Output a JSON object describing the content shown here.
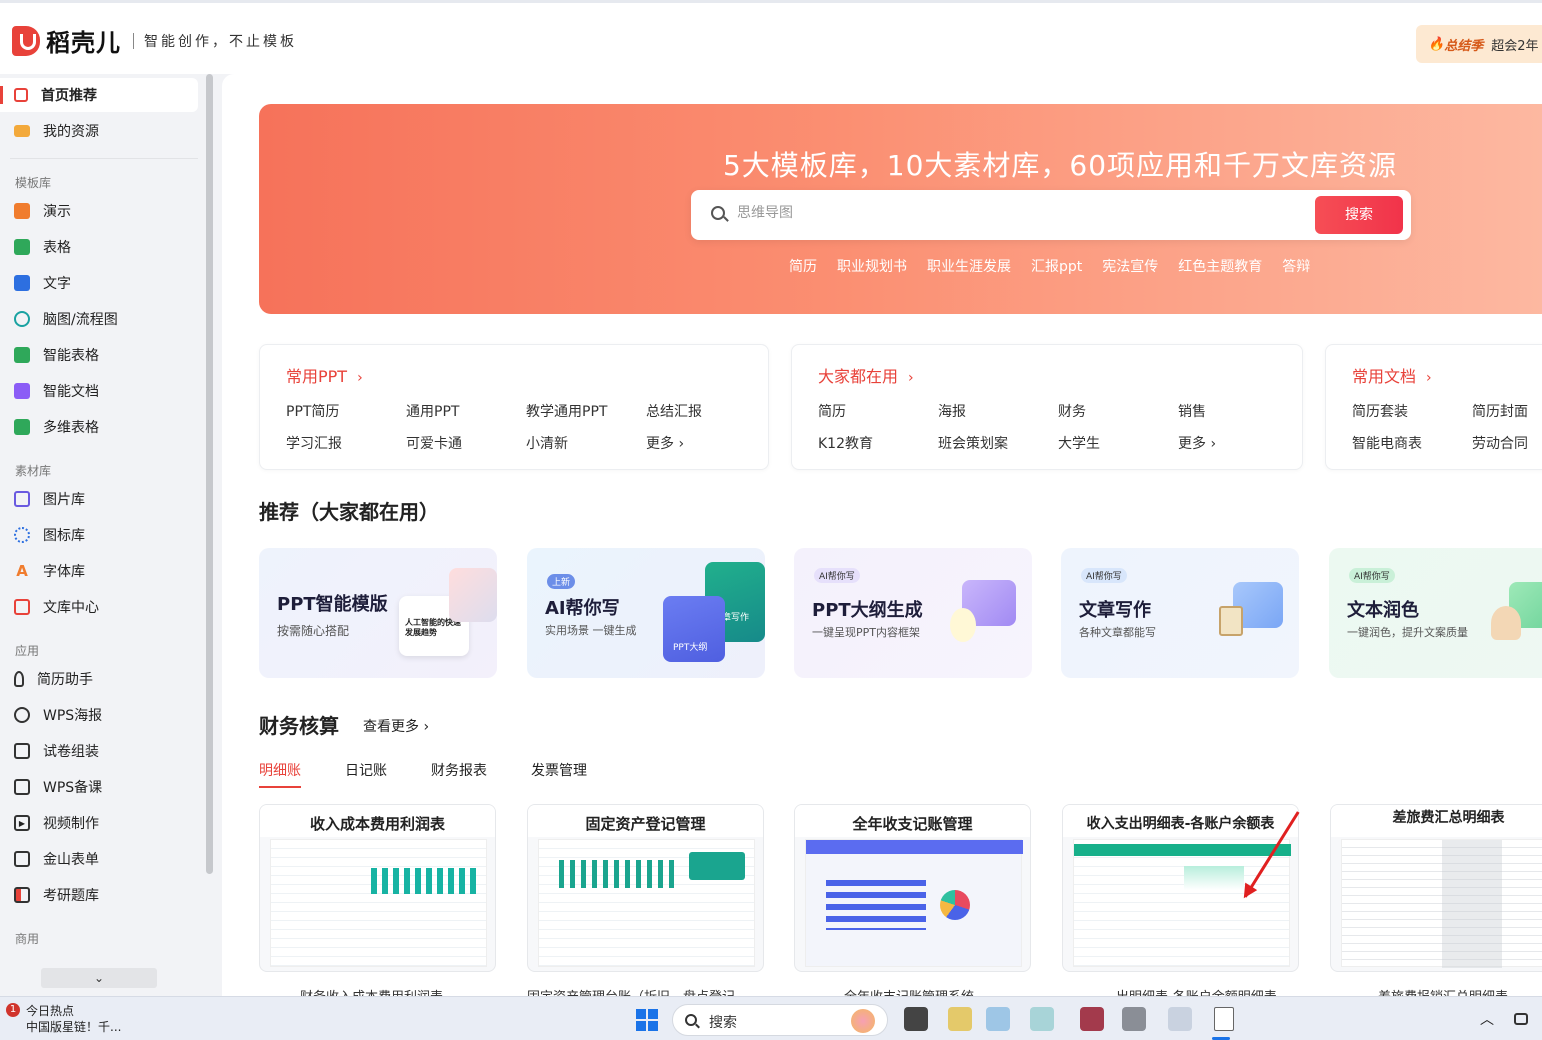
{
  "app": {
    "brand": "稻壳儿",
    "slogan": "智能创作，不止模板",
    "promo_label": "总结季",
    "promo_text": "超会2年"
  },
  "sidebar": {
    "top_items": [
      {
        "label": "首页推荐",
        "icon": "home-icon",
        "active": true
      },
      {
        "label": "我的资源",
        "icon": "folder-icon",
        "active": false
      }
    ],
    "sections": [
      {
        "title": "模板库",
        "items": [
          {
            "label": "演示",
            "icon": "presentation-icon"
          },
          {
            "label": "表格",
            "icon": "table-icon"
          },
          {
            "label": "文字",
            "icon": "document-icon"
          },
          {
            "label": "脑图/流程图",
            "icon": "mindmap-icon"
          },
          {
            "label": "智能表格",
            "icon": "smart-table-icon"
          },
          {
            "label": "智能文档",
            "icon": "smart-doc-icon"
          },
          {
            "label": "多维表格",
            "icon": "multidim-table-icon"
          }
        ]
      },
      {
        "title": "素材库",
        "items": [
          {
            "label": "图片库",
            "icon": "image-icon"
          },
          {
            "label": "图标库",
            "icon": "icons-icon"
          },
          {
            "label": "字体库",
            "icon": "font-icon"
          },
          {
            "label": "文库中心",
            "icon": "library-icon"
          }
        ]
      },
      {
        "title": "应用",
        "items": [
          {
            "label": "简历助手",
            "icon": "resume-icon"
          },
          {
            "label": "WPS海报",
            "icon": "poster-icon"
          },
          {
            "label": "试卷组装",
            "icon": "exam-icon"
          },
          {
            "label": "WPS备课",
            "icon": "lesson-icon"
          },
          {
            "label": "视频制作",
            "icon": "video-icon"
          },
          {
            "label": "金山表单",
            "icon": "form-icon"
          },
          {
            "label": "考研题库",
            "icon": "question-bank-icon"
          }
        ]
      },
      {
        "title": "商用",
        "items": []
      }
    ],
    "scroll_down": "⌄"
  },
  "banner": {
    "title": "5大模板库，10大素材库，60项应用和千万文库资源",
    "search_placeholder": "思维导图",
    "search_button": "搜索",
    "tags": [
      "简历",
      "职业规划书",
      "职业生涯发展",
      "汇报ppt",
      "宪法宣传",
      "红色主题教育",
      "答辩"
    ]
  },
  "quick_cards": [
    {
      "title": "常用PPT",
      "links": [
        "PPT简历",
        "通用PPT",
        "教学通用PPT",
        "总结汇报",
        "学习汇报",
        "可爱卡通",
        "小清新",
        "更多 ›"
      ]
    },
    {
      "title": "大家都在用",
      "links": [
        "简历",
        "海报",
        "财务",
        "销售",
        "K12教育",
        "班会策划案",
        "大学生",
        "更多 ›"
      ]
    },
    {
      "title": "常用文档",
      "links": [
        "简历套装",
        "简历封面",
        "智能电商表",
        "劳动合同"
      ]
    }
  ],
  "recommend": {
    "heading": "推荐（大家都在用）",
    "cards": [
      {
        "badge": "",
        "title": "PPT智能模版",
        "subtitle": "按需随心搭配",
        "art": "人工智能的快速发展趋势"
      },
      {
        "badge": "上新",
        "title": "AI帮你写",
        "subtitle": "实用场景 一键生成",
        "art": "文章写作",
        "art2": "PPT大纲"
      },
      {
        "badge": "AI帮你写",
        "title": "PPT大纲生成",
        "subtitle": "一键呈现PPT内容框架",
        "art": ""
      },
      {
        "badge": "AI帮你写",
        "title": "文章写作",
        "subtitle": "各种文章都能写",
        "art": ""
      },
      {
        "badge": "AI帮你写",
        "title": "文本润色",
        "subtitle": "一键润色，提升文案质量",
        "art": ""
      }
    ]
  },
  "finance": {
    "heading": "财务核算",
    "more": "查看更多 ›",
    "tabs": [
      "明细账",
      "日记账",
      "财务报表",
      "发票管理"
    ],
    "templates": [
      {
        "head": "收入成本费用利润表",
        "caption": "财务收入成本费用利润表"
      },
      {
        "head": "固定资产登记管理",
        "caption": "固定资产管理台账（折旧、盘点登记"
      },
      {
        "head": "全年收支记账管理",
        "caption": "全年收支记账管理系统"
      },
      {
        "head": "收入支出明细表-各账户余额表",
        "caption": "出明细表-各账户余额明细表"
      },
      {
        "head": "差旅费汇总明细表",
        "caption": "差旅费报销汇总明细表"
      }
    ]
  },
  "taskbar": {
    "news_title": "今日热点",
    "news_text": "中国版星链！千...",
    "news_badge": "1",
    "search_label": "搜索"
  },
  "colors": {
    "accent": "#e8423a",
    "banner_start": "#f6725a",
    "banner_end": "#fdb9a2"
  }
}
